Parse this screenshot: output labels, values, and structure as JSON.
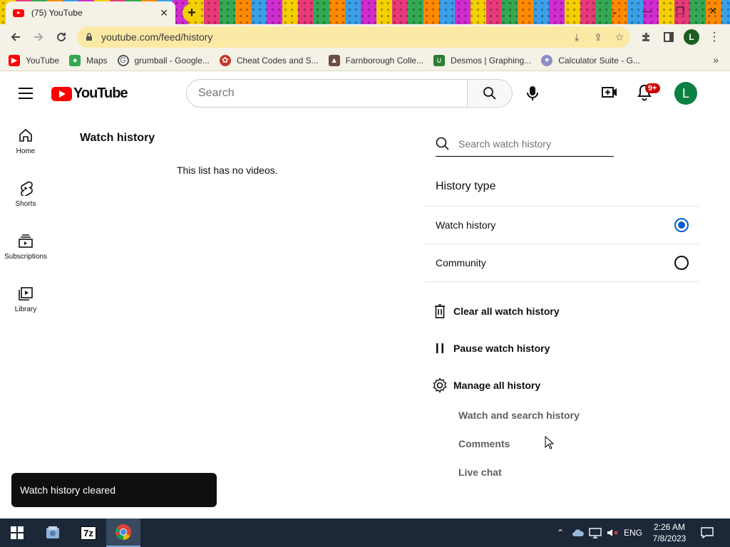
{
  "browser": {
    "tab_title": "(75) YouTube",
    "tab_close": "✕",
    "new_tab": "+",
    "url": "youtube.com/feed/history",
    "profile_initial": "L",
    "bookmarks": [
      {
        "label": "YouTube",
        "color": "#ff0000"
      },
      {
        "label": "Maps",
        "color": "#34a853"
      },
      {
        "label": "grumball - Google...",
        "color": "#ffffff"
      },
      {
        "label": "Cheat Codes and S...",
        "color": "#c0392b"
      },
      {
        "label": "Farnborough Colle...",
        "color": "#6d4c41"
      },
      {
        "label": "Desmos | Graphing...",
        "color": "#2e7d32"
      },
      {
        "label": "Calculator Suite - G...",
        "color": "#8e8ec6"
      }
    ],
    "bookmarks_more": "»"
  },
  "youtube": {
    "logo_text": "YouTube",
    "search_placeholder": "Search",
    "notification_badge": "9+",
    "avatar_initial": "L",
    "guide": [
      {
        "label": "Home",
        "icon": "home-icon"
      },
      {
        "label": "Shorts",
        "icon": "shorts-icon"
      },
      {
        "label": "Subscriptions",
        "icon": "subscriptions-icon"
      },
      {
        "label": "Library",
        "icon": "library-icon"
      }
    ],
    "page_title": "Watch history",
    "empty_message": "This list has no videos.",
    "history_search_placeholder": "Search watch history",
    "history_type_title": "History type",
    "history_types": [
      {
        "label": "Watch history",
        "selected": true
      },
      {
        "label": "Community",
        "selected": false
      }
    ],
    "actions": {
      "clear": "Clear all watch history",
      "pause": "Pause watch history",
      "manage": "Manage all history"
    },
    "sub_links": [
      "Watch and search history",
      "Comments",
      "Live chat"
    ],
    "toast": "Watch history cleared",
    "accent_color": "#065fd4",
    "brand_color": "#ff0000"
  },
  "taskbar": {
    "language": "ENG",
    "time": "2:26 AM",
    "date": "7/8/2023",
    "app_7z": "7z"
  }
}
